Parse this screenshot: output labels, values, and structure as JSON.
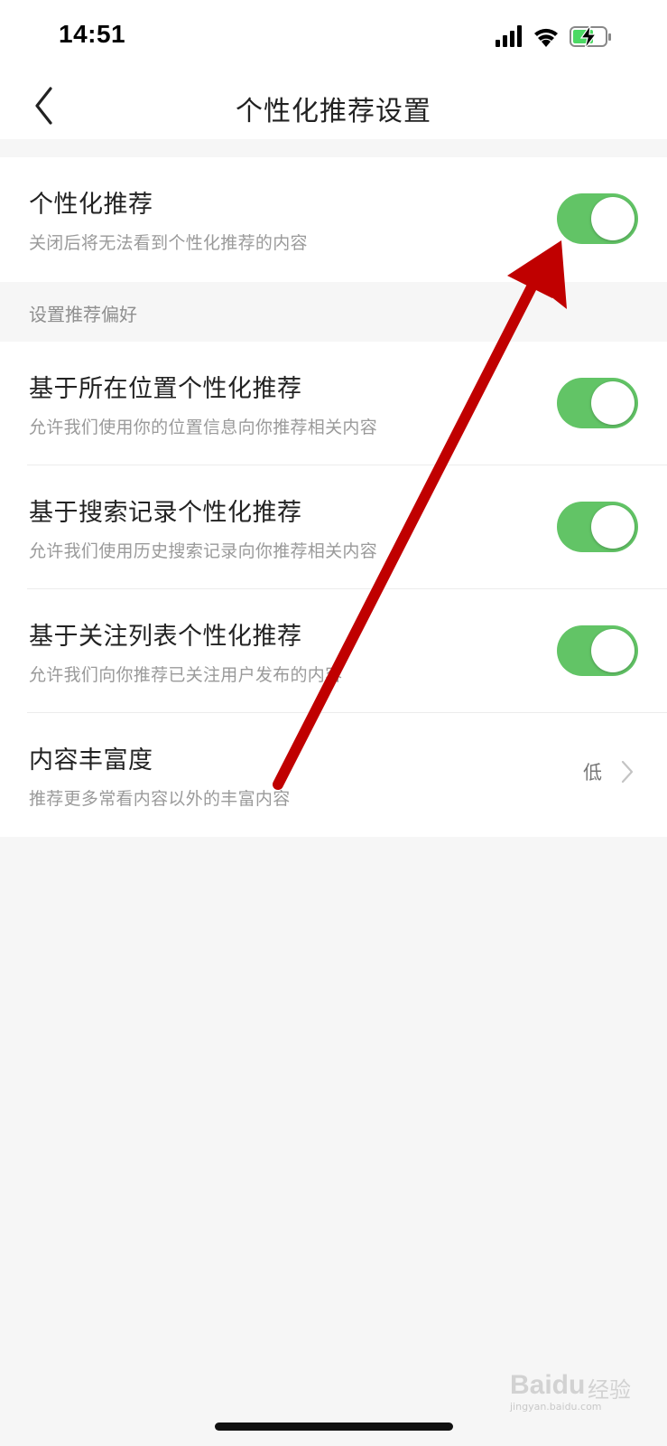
{
  "status_bar": {
    "time": "14:51",
    "icons": [
      "signal-icon",
      "wifi-icon",
      "battery-charging-icon"
    ]
  },
  "nav": {
    "title": "个性化推荐设置",
    "back_icon": "chevron-left-icon"
  },
  "main_toggle": {
    "title": "个性化推荐",
    "subtitle": "关闭后将无法看到个性化推荐的内容",
    "enabled": true
  },
  "preferences": {
    "header": "设置推荐偏好",
    "items": [
      {
        "title": "基于所在位置个性化推荐",
        "subtitle": "允许我们使用你的位置信息向你推荐相关内容",
        "enabled": true
      },
      {
        "title": "基于搜索记录个性化推荐",
        "subtitle": "允许我们使用历史搜索记录向你推荐相关内容",
        "enabled": true
      },
      {
        "title": "基于关注列表个性化推荐",
        "subtitle": "允许我们向你推荐已关注用户发布的内容",
        "enabled": true
      }
    ],
    "richness": {
      "title": "内容丰富度",
      "subtitle": "推荐更多常看内容以外的丰富内容",
      "value": "低"
    }
  },
  "watermark": {
    "brand": "Baidu",
    "brand_cn": "经验",
    "url": "jingyan.baidu.com"
  },
  "colors": {
    "toggle_on": "#62c466",
    "arrow": "#c00000",
    "background": "#f6f6f6"
  }
}
